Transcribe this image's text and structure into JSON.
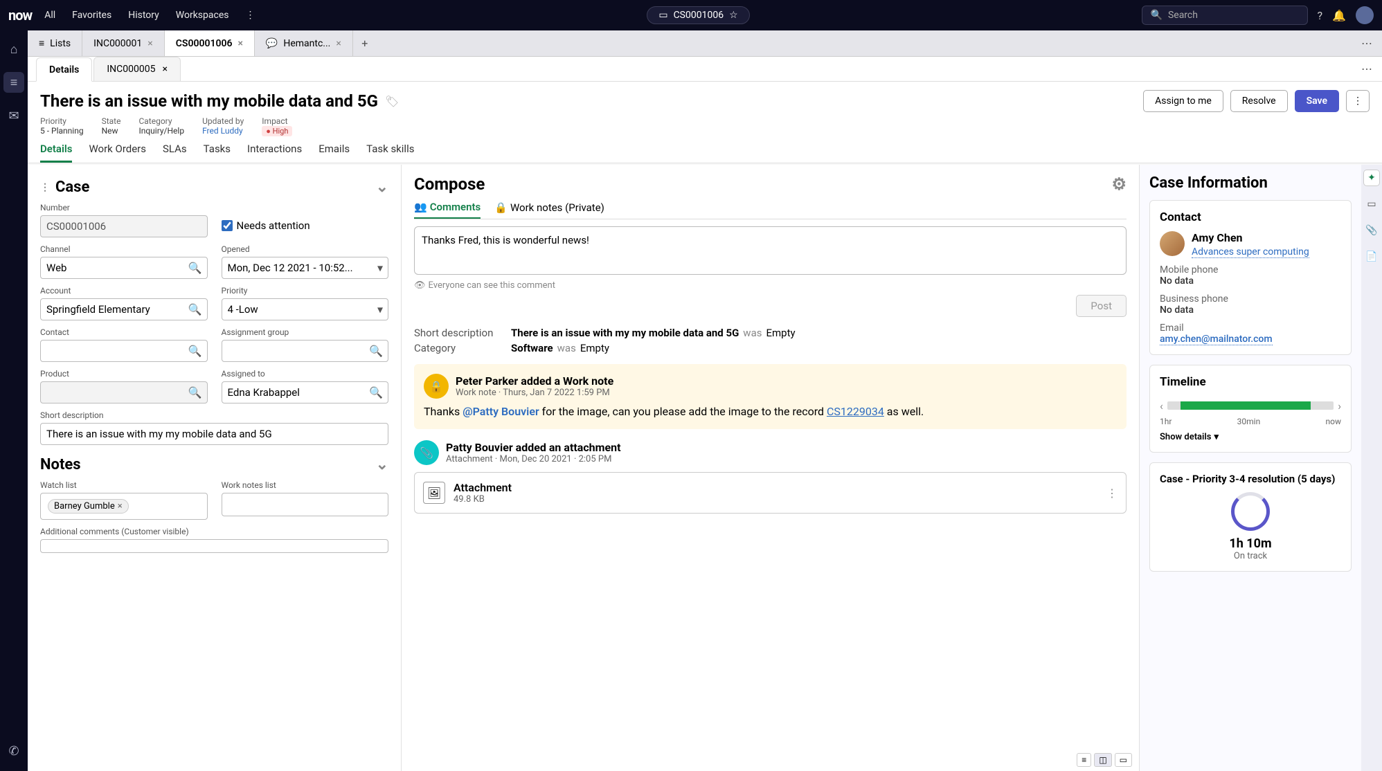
{
  "topbar": {
    "logo": "now",
    "nav": [
      "All",
      "Favorites",
      "History",
      "Workspaces"
    ],
    "pill": {
      "record": "CS0001006"
    },
    "search_placeholder": "Search"
  },
  "tabs": [
    {
      "label": "Lists",
      "icon": true,
      "closable": false
    },
    {
      "label": "INC000001",
      "closable": true
    },
    {
      "label": "CS00001006",
      "closable": true,
      "active": true
    },
    {
      "label": "Hemantc...",
      "closable": true,
      "chat": true
    }
  ],
  "subtabs": [
    {
      "label": "Details",
      "active": true
    },
    {
      "label": "INC000005",
      "closable": true
    }
  ],
  "header": {
    "title": "There is an issue with my mobile data and 5G",
    "actions": {
      "assign": "Assign to me",
      "resolve": "Resolve",
      "save": "Save"
    },
    "meta": {
      "priority": {
        "label": "Priority",
        "value": "5 - Planning"
      },
      "state": {
        "label": "State",
        "value": "New"
      },
      "category": {
        "label": "Category",
        "value": "Inquiry/Help"
      },
      "updated_by": {
        "label": "Updated by",
        "value": "Fred Luddy"
      },
      "impact": {
        "label": "Impact",
        "value": "High"
      }
    },
    "record_tabs": [
      "Details",
      "Work Orders",
      "SLAs",
      "Tasks",
      "Interactions",
      "Emails",
      "Task skills"
    ]
  },
  "case_form": {
    "section": "Case",
    "number": {
      "label": "Number",
      "value": "CS00001006"
    },
    "needs_attention": {
      "label": "Needs attention",
      "checked": true
    },
    "channel": {
      "label": "Channel",
      "value": "Web"
    },
    "opened": {
      "label": "Opened",
      "value": "Mon, Dec 12 2021 - 10:52..."
    },
    "account": {
      "label": "Account",
      "value": "Springfield Elementary"
    },
    "priority": {
      "label": "Priority",
      "value": "4 -Low"
    },
    "contact": {
      "label": "Contact",
      "value": ""
    },
    "assignment_group": {
      "label": "Assignment group",
      "value": ""
    },
    "product": {
      "label": "Product",
      "value": ""
    },
    "assigned_to": {
      "label": "Assigned to",
      "value": "Edna Krabappel"
    },
    "short_desc": {
      "label": "Short description",
      "value": "There is an issue with my my mobile data and 5G"
    },
    "notes_section": "Notes",
    "watch_list": {
      "label": "Watch list",
      "chips": [
        "Barney Gumble"
      ]
    },
    "work_notes_list": {
      "label": "Work notes list"
    },
    "additional_comments": {
      "label": "Additional comments (Customer visible)"
    }
  },
  "compose": {
    "title": "Compose",
    "tabs": {
      "comments": "Comments",
      "work_notes": "Work notes (Private)"
    },
    "draft": "Thanks Fred, this is wonderful news!",
    "hint": "Everyone can see this comment",
    "post": "Post",
    "field_changes": {
      "short_desc": {
        "label": "Short description",
        "new": "There is an issue with my my mobile data and 5G",
        "was": "was",
        "old": "Empty"
      },
      "category": {
        "label": "Category",
        "new": "Software",
        "was": "was",
        "old": "Empty"
      }
    },
    "work_note": {
      "title": "Peter Parker added a Work note",
      "sub": "Work note   ·   Thurs, Jan 7 2022 1:59 PM",
      "body_pre": "Thanks ",
      "mention": "@Patty Bouvier",
      "body_mid": " for the image, can you please add the image to the record ",
      "record_link": "CS1229034",
      "body_post": " as well."
    },
    "attachment_entry": {
      "title": "Patty Bouvier added an attachment",
      "sub": "Attachment   ·   Mon, Dec 20 2021  ·  2:05 PM",
      "name": "Attachment",
      "size": "49.8 KB"
    }
  },
  "right": {
    "title": "Case Information",
    "contact": {
      "heading": "Contact",
      "name": "Amy Chen",
      "sub": "Advances super computing",
      "mobile": {
        "label": "Mobile phone",
        "value": "No data"
      },
      "business": {
        "label": "Business phone",
        "value": "No data"
      },
      "email": {
        "label": "Email",
        "value": "amy.chen@mailnator.com"
      }
    },
    "timeline": {
      "heading": "Timeline",
      "labels": [
        "1hr",
        "30min",
        "now"
      ],
      "show_details": "Show details"
    },
    "sla": {
      "heading": "Case - Priority 3-4 resolution (5 days)",
      "time": "1h 10m",
      "status": "On track"
    }
  }
}
